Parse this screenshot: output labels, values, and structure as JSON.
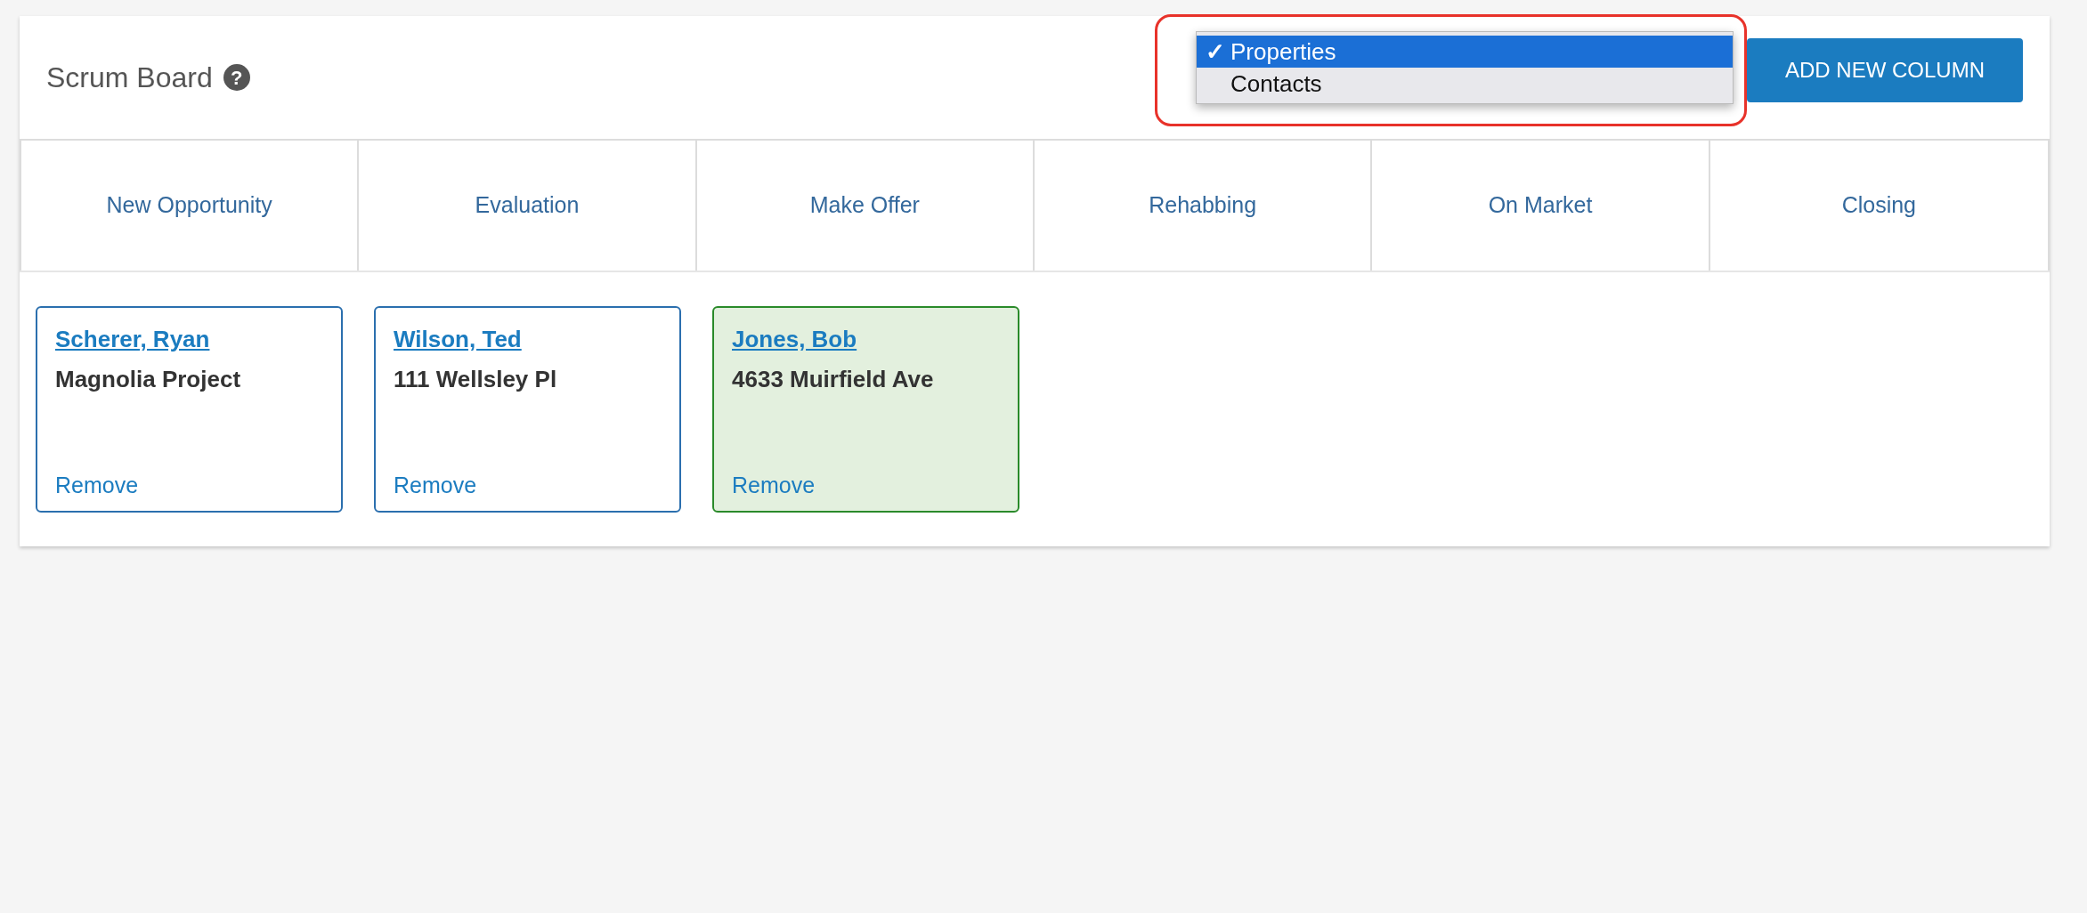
{
  "header": {
    "title": "Scrum Board",
    "help_icon": "?",
    "button": "ADD NEW COLUMN"
  },
  "dropdown": {
    "options": [
      {
        "label": "Properties",
        "mark": "✓",
        "selected": true
      },
      {
        "label": "Contacts",
        "selected": false
      }
    ]
  },
  "columns": [
    "New Opportunity",
    "Evaluation",
    "Make Offer",
    "Rehabbing",
    "On Market",
    "Closing"
  ],
  "cards": [
    {
      "name": "Scherer, Ryan",
      "subtitle": "Magnolia Project",
      "action": "Remove",
      "highlighted": false
    },
    {
      "name": "Wilson, Ted",
      "subtitle": "111 Wellsley Pl",
      "action": "Remove",
      "highlighted": false
    },
    {
      "name": "Jones, Bob",
      "subtitle": "4633 Muirfield Ave",
      "action": "Remove",
      "highlighted": true
    }
  ]
}
